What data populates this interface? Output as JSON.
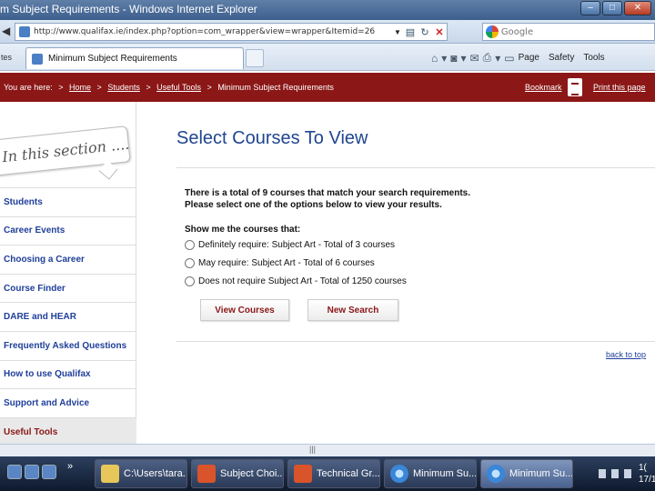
{
  "window": {
    "title": "m Subject Requirements - Windows Internet Explorer"
  },
  "address_bar": {
    "url": "http://www.qualifax.ie/index.php?option=com_wrapper&view=wrapper&Itemid=26",
    "search_placeholder": "Google"
  },
  "tab_bar": {
    "partial_left": "tes",
    "active_tab": "Minimum Subject Requirements",
    "commands": {
      "page": "Page",
      "safety": "Safety",
      "tools": "Tools"
    }
  },
  "site_bar": {
    "prefix": "You are here:",
    "breadcrumb": [
      "Home",
      "Students",
      "Useful Tools"
    ],
    "current": "Minimum Subject Requirements",
    "separator": ">",
    "bookmark": "Bookmark",
    "print": "Print this page"
  },
  "sidebar": {
    "section_title": "In this section ....",
    "items": [
      {
        "label": "Students"
      },
      {
        "label": "Career Events"
      },
      {
        "label": "Choosing a Career"
      },
      {
        "label": "Course Finder"
      },
      {
        "label": "DARE and HEAR"
      },
      {
        "label": "Frequently Asked Questions"
      },
      {
        "label": "How to use Qualifax"
      },
      {
        "label": "Support and Advice"
      },
      {
        "label": "Useful Tools"
      }
    ]
  },
  "main": {
    "title": "Select Courses To View",
    "message_line1": "There is a total of 9 courses that match your search requirements.",
    "message_line2": "Please select one of the options below to view your results.",
    "show_me": "Show me the courses that:",
    "options": [
      {
        "label": "Definitely require: Subject Art - Total of 3 courses"
      },
      {
        "label": "May require: Subject Art - Total of 6 courses"
      },
      {
        "label": "Does not require Subject Art - Total of 1250 courses"
      }
    ],
    "view_button": "View Courses",
    "new_search_button": "New Search",
    "back_to_top": "back to top"
  },
  "taskbar": {
    "more": "»",
    "items": [
      {
        "label": "C:\\Users\\tara...",
        "icon": "folder-icon"
      },
      {
        "label": "Subject Choi...",
        "icon": "powerpoint-icon"
      },
      {
        "label": "Technical Gr...",
        "icon": "powerpoint-icon"
      },
      {
        "label": "Minimum Su...",
        "icon": "ie-icon"
      },
      {
        "label": "Minimum Su...",
        "icon": "ie-icon"
      }
    ],
    "clock_time": "1(",
    "clock_date": "17/1"
  },
  "colors": {
    "brand_red": "#8b1717",
    "title_blue": "#1f4590",
    "link_blue": "#1f3f9a"
  }
}
